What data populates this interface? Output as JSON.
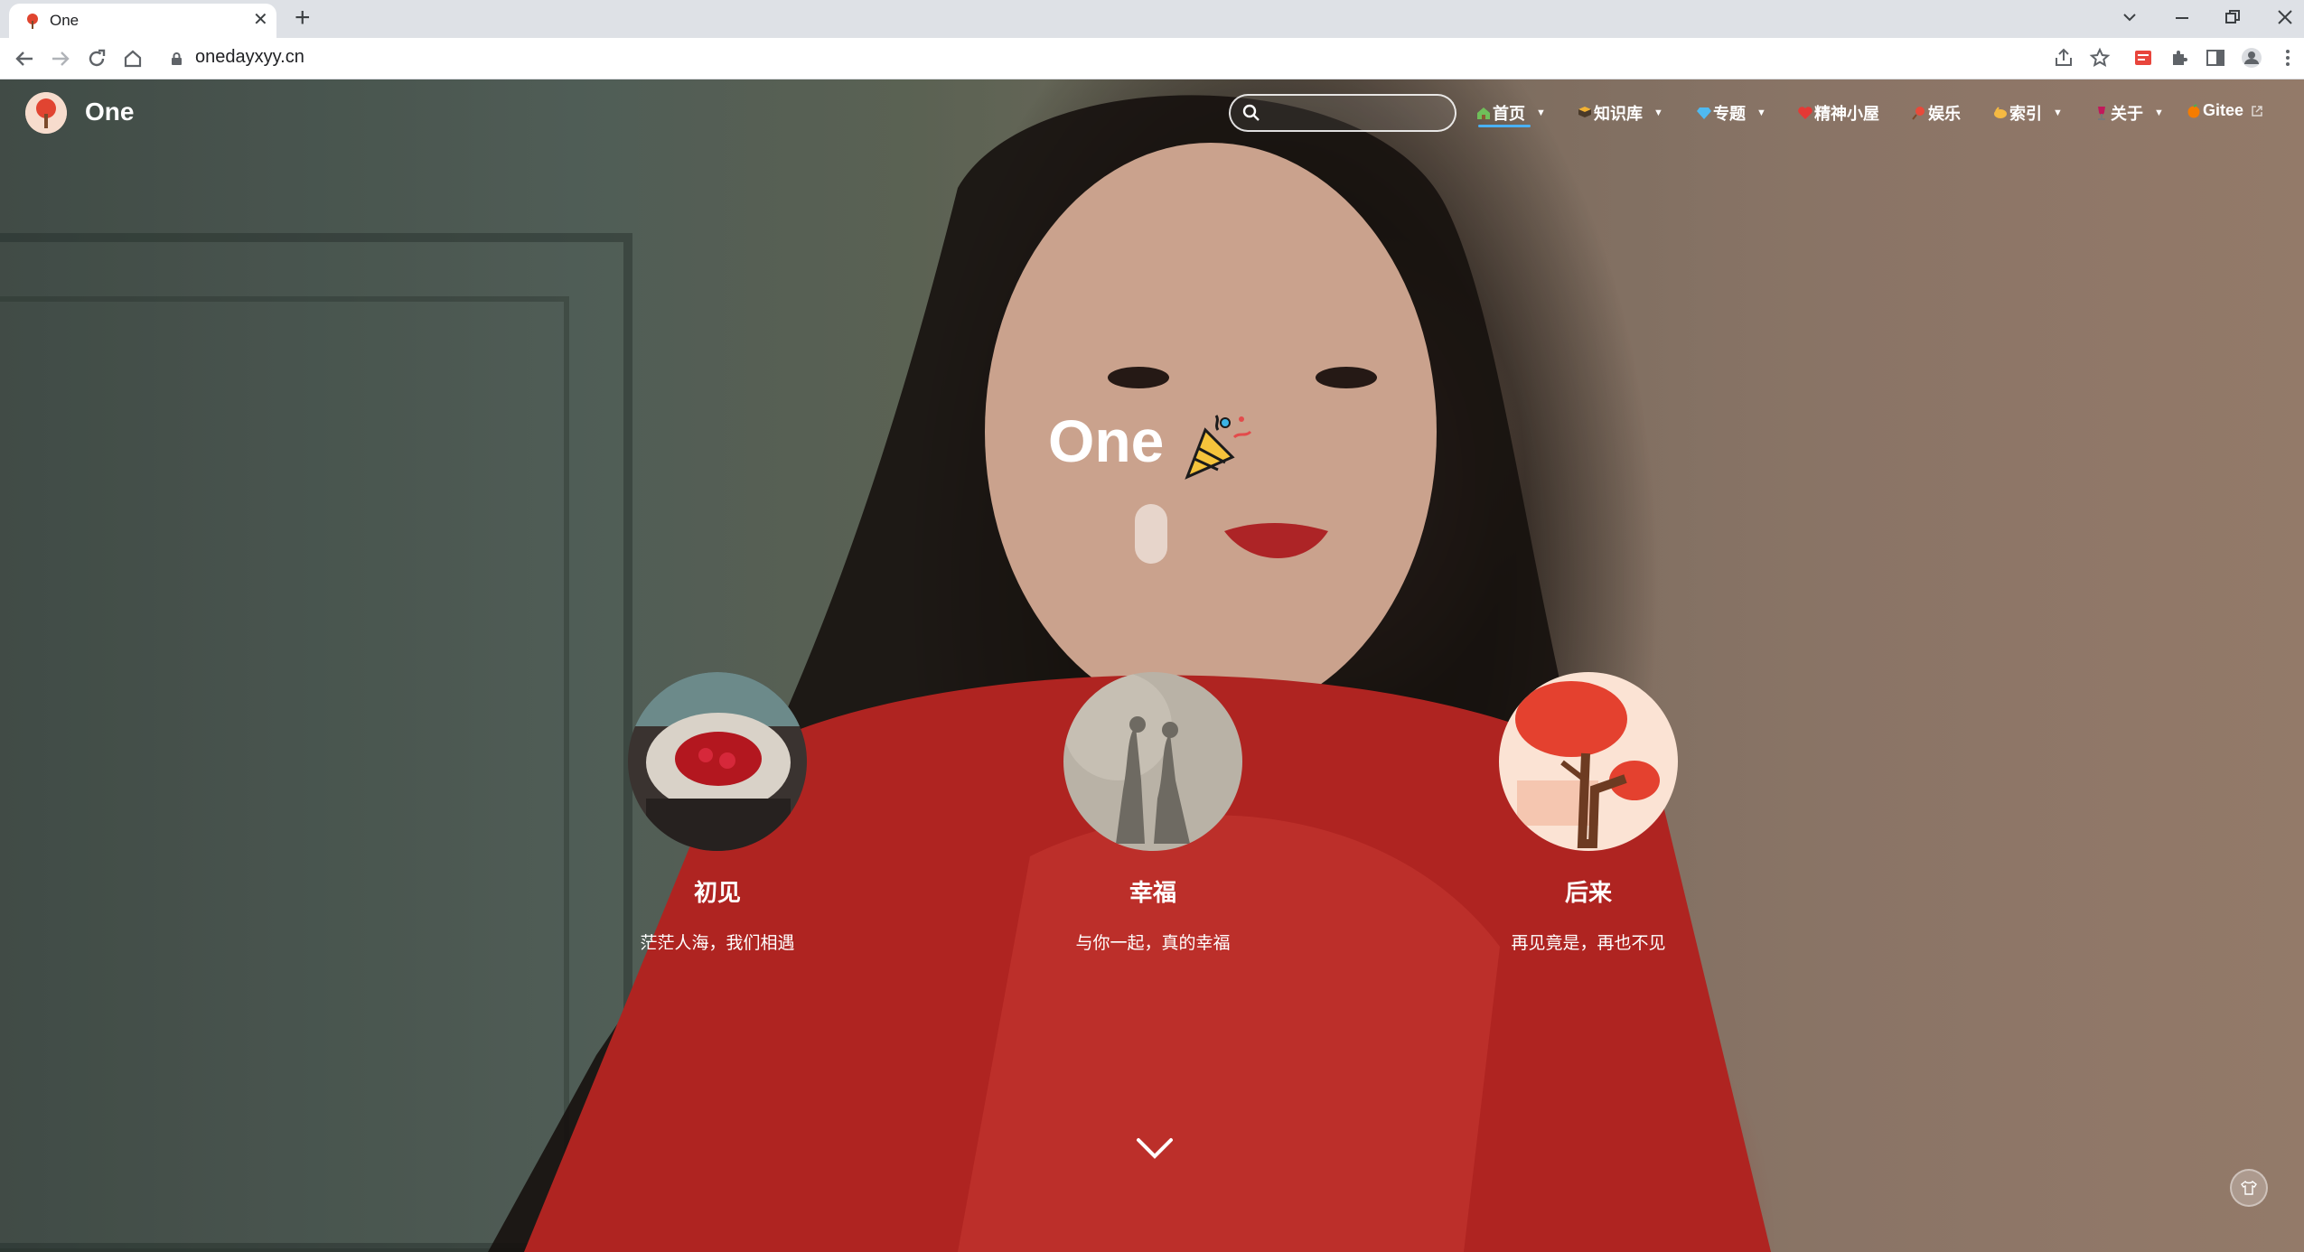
{
  "browser": {
    "tab_title": "One",
    "url": "onedayxyy.cn",
    "new_tab": "+",
    "close": "✕"
  },
  "site": {
    "name": "One",
    "search_placeholder": "",
    "menu": [
      {
        "label": "首页",
        "icon": "home-icon",
        "caret": true
      },
      {
        "label": "知识库",
        "icon": "book-icon",
        "caret": true
      },
      {
        "label": "专题",
        "icon": "diamond-icon",
        "caret": true
      },
      {
        "label": "精神小屋",
        "icon": "heart-icon",
        "caret": false
      },
      {
        "label": "娱乐",
        "icon": "lollipop-icon",
        "caret": false
      },
      {
        "label": "索引",
        "icon": "clap-icon",
        "caret": true
      },
      {
        "label": "关于",
        "icon": "wine-icon",
        "caret": true
      },
      {
        "label": "Gitee",
        "icon": "orange-icon",
        "caret": false,
        "external": true
      }
    ]
  },
  "hero": {
    "title": "One",
    "cards": [
      {
        "title": "初见",
        "desc": "茫茫人海，我们相遇"
      },
      {
        "title": "幸福",
        "desc": "与你一起，真的幸福"
      },
      {
        "title": "后来",
        "desc": "再见竟是，再也不见"
      }
    ]
  },
  "colors": {
    "accent": "#49b1f5",
    "dress_red": "#c92a25",
    "tab_bar": "#dee1e6"
  }
}
